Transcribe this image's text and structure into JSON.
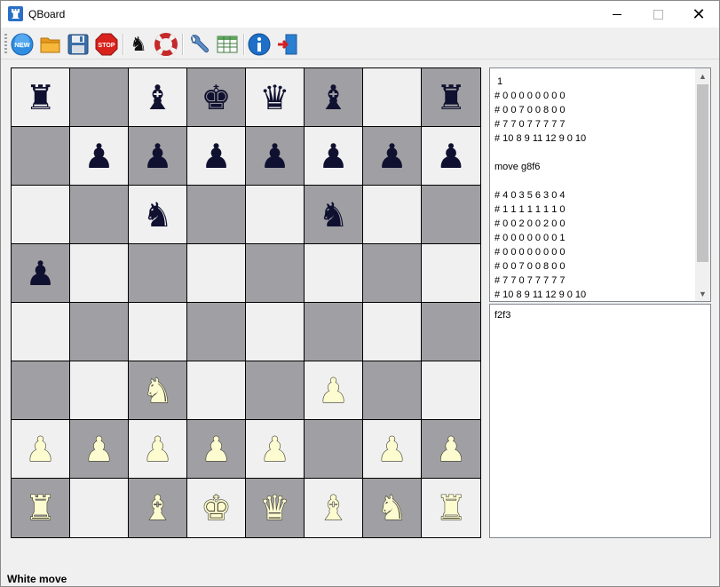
{
  "window": {
    "title": "QBoard"
  },
  "toolbar": {
    "buttons": [
      {
        "name": "new-game-button",
        "icon": "new-icon",
        "label": "NEW"
      },
      {
        "name": "open-button",
        "icon": "folder-icon"
      },
      {
        "name": "save-button",
        "icon": "floppy-icon"
      },
      {
        "name": "stop-button",
        "icon": "stop-icon",
        "label": "STOP"
      },
      {
        "name": "engine-button",
        "icon": "chess-knight-icon"
      },
      {
        "name": "flip-button",
        "icon": "lifebuoy-icon"
      },
      {
        "name": "settings-button",
        "icon": "wrench-icon"
      },
      {
        "name": "table-button",
        "icon": "table-icon"
      },
      {
        "name": "about-button",
        "icon": "info-icon"
      },
      {
        "name": "exit-button",
        "icon": "exit-door-icon"
      }
    ]
  },
  "board": {
    "colors": {
      "light": "#f0f0f0",
      "dark": "#a0a0a4",
      "white_piece": "#fdfbd0",
      "black_piece": "#101030"
    },
    "ranks": [
      [
        "br",
        "",
        "bb",
        "bk",
        "bq",
        "bb",
        "",
        "br"
      ],
      [
        "",
        "bp",
        "bp",
        "bp",
        "bp",
        "bp",
        "bp",
        "bp"
      ],
      [
        "",
        "",
        "bn",
        "",
        "",
        "bn",
        "",
        ""
      ],
      [
        "bp",
        "",
        "",
        "",
        "",
        "",
        "",
        ""
      ],
      [
        "",
        "",
        "",
        "",
        "",
        "",
        "",
        ""
      ],
      [
        "",
        "",
        "wn",
        "",
        "",
        "wp",
        "",
        ""
      ],
      [
        "wp",
        "wp",
        "wp",
        "wp",
        "wp",
        "",
        "wp",
        "wp"
      ],
      [
        "wr",
        "",
        "wb",
        "wk",
        "wq",
        "wb",
        "wn",
        "wr"
      ]
    ]
  },
  "log": {
    "lines": [
      " 1",
      "# 0 0 0 0 0 0 0 0",
      "# 0 0 7 0 0 8 0 0",
      "# 7 7 0 7 7 7 7 7",
      "# 10 8 9 11 12 9 0 10",
      "",
      "move g8f6",
      "",
      "# 4 0 3 5 6 3 0 4",
      "# 1 1 1 1 1 1 1 0",
      "# 0 0 2 0 0 2 0 0",
      "# 0 0 0 0 0 0 0 1",
      "# 0 0 0 0 0 0 0 0",
      "# 0 0 7 0 0 8 0 0",
      "# 7 7 0 7 7 7 7 7",
      "# 10 8 9 11 12 9 0 10"
    ]
  },
  "input": {
    "text": "f2f3"
  },
  "status": {
    "text": "White move"
  }
}
